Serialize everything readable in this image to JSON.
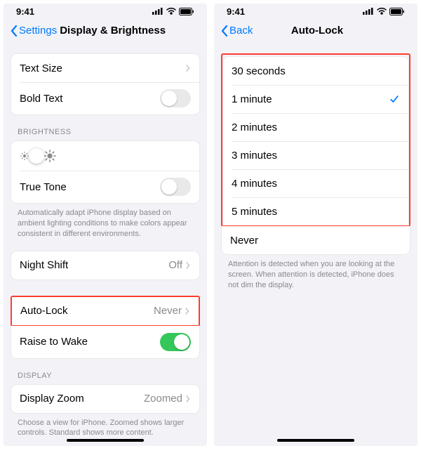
{
  "status_time": "9:41",
  "left": {
    "back": "Settings",
    "title": "Display & Brightness",
    "items": {
      "text_size": "Text Size",
      "bold_text": "Bold Text"
    },
    "brightness_header": "BRIGHTNESS",
    "true_tone": "True Tone",
    "true_tone_footer": "Automatically adapt iPhone display based on ambient lighting conditions to make colors appear consistent in different environments.",
    "night_shift": "Night Shift",
    "night_shift_value": "Off",
    "auto_lock": "Auto-Lock",
    "auto_lock_value": "Never",
    "raise_to_wake": "Raise to Wake",
    "display_header": "DISPLAY",
    "display_zoom": "Display Zoom",
    "display_zoom_value": "Zoomed",
    "display_zoom_footer": "Choose a view for iPhone. Zoomed shows larger controls. Standard shows more content."
  },
  "right": {
    "back": "Back",
    "title": "Auto-Lock",
    "options": {
      "o30s": "30 seconds",
      "o1m": "1 minute",
      "o2m": "2 minutes",
      "o3m": "3 minutes",
      "o4m": "4 minutes",
      "o5m": "5 minutes",
      "never": "Never"
    },
    "selected": "1 minute",
    "footer": "Attention is detected when you are looking at the screen. When attention is detected, iPhone does not dim the display."
  }
}
